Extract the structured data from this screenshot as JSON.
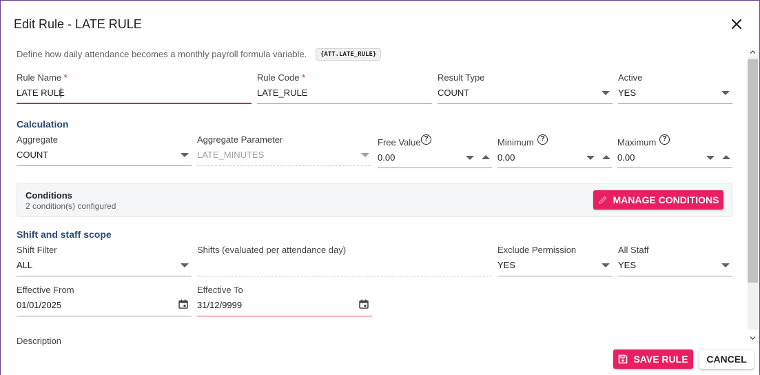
{
  "dialog": {
    "title": "Edit Rule - LATE RULE",
    "intro": "Define how daily attendance becomes a monthly payroll formula variable.",
    "variable_chip": "{ATT.LATE_RULE}"
  },
  "fields": {
    "rule_name": {
      "label": "Rule Name",
      "required": "*",
      "value": "LATE RULE"
    },
    "rule_code": {
      "label": "Rule Code",
      "required": "*",
      "value": "LATE_RULE"
    },
    "result_type": {
      "label": "Result Type",
      "value": "COUNT"
    },
    "active": {
      "label": "Active",
      "value": "YES"
    }
  },
  "calculation": {
    "heading": "Calculation",
    "aggregate": {
      "label": "Aggregate",
      "value": "COUNT"
    },
    "aggregate_parameter": {
      "label": "Aggregate Parameter",
      "value": "LATE_MINUTES"
    },
    "free_value": {
      "label": "Free Value",
      "value": "0.00"
    },
    "minimum": {
      "label": "Minimum",
      "value": "0.00"
    },
    "maximum": {
      "label": "Maximum",
      "value": "0.00"
    }
  },
  "conditions": {
    "title": "Conditions",
    "summary": "2 condition(s) configured",
    "manage_label": "MANAGE CONDITIONS"
  },
  "scope": {
    "heading": "Shift and staff scope",
    "shift_filter": {
      "label": "Shift Filter",
      "value": "ALL"
    },
    "shifts": {
      "label": "Shifts (evaluated per attendance day)",
      "value": ""
    },
    "exclude_permission": {
      "label": "Exclude Permission",
      "value": "YES"
    },
    "all_staff": {
      "label": "All Staff",
      "value": "YES"
    },
    "effective_from": {
      "label": "Effective From",
      "value": "01/01/2025"
    },
    "effective_to": {
      "label": "Effective To",
      "value": "31/12/9999"
    },
    "description": {
      "label": "Description"
    }
  },
  "actions": {
    "save_label": "SAVE RULE",
    "cancel_label": "CANCEL"
  },
  "colors": {
    "accent": "#e91e63",
    "section_heading": "#2b4a6f",
    "focus_underline": "#d81b60"
  },
  "icons": {
    "close": "close-icon",
    "help": "help-circle-icon",
    "calendar": "calendar-icon",
    "pencil": "pencil-icon",
    "save": "floppy-disk-icon"
  }
}
